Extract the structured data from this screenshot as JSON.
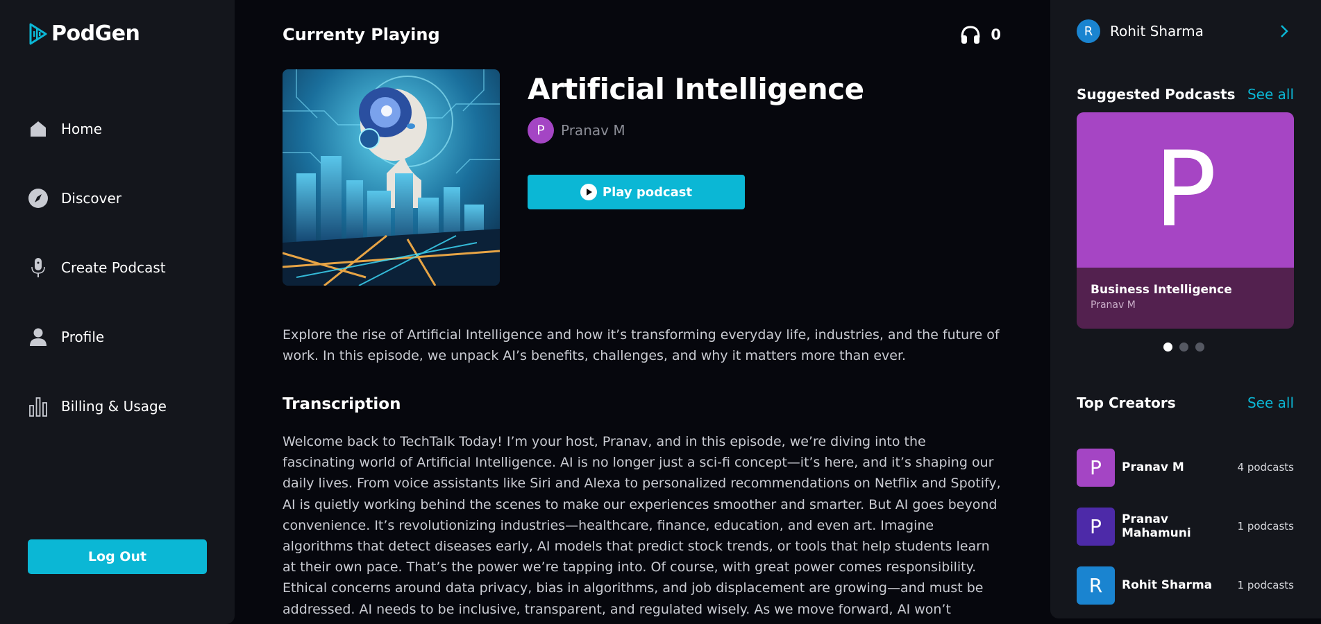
{
  "app": {
    "name": "PodGen"
  },
  "sidebar": {
    "items": [
      {
        "label": "Home",
        "icon": "home-icon"
      },
      {
        "label": "Discover",
        "icon": "compass-icon"
      },
      {
        "label": "Create Podcast",
        "icon": "microphone-icon"
      },
      {
        "label": "Profile",
        "icon": "user-icon"
      },
      {
        "label": "Billing & Usage",
        "icon": "bar-chart-icon"
      }
    ],
    "logout_label": "Log Out"
  },
  "main": {
    "section_title": "Currenty Playing",
    "listeners": "0",
    "podcast": {
      "title": "Artificial Intelligence",
      "author_initial": "P",
      "author": "Pranav M",
      "play_label": "Play podcast",
      "description": "Explore the rise of Artificial Intelligence and how it’s transforming everyday life, industries, and the future of work. In this episode, we unpack AI’s benefits, challenges, and why it matters more than ever."
    },
    "transcription_title": "Transcription",
    "transcription_text": "Welcome back to TechTalk Today! I’m your host, Pranav, and in this episode, we’re diving into the fascinating world of Artificial Intelligence. AI is no longer just a sci-fi concept—it’s here, and it’s shaping our daily lives. From voice assistants like Siri and Alexa to personalized recommendations on Netflix and Spotify, AI is quietly working behind the scenes to make our experiences smoother and smarter. But AI goes beyond convenience. It’s revolutionizing industries—healthcare, finance, education, and even art. Imagine algorithms that detect diseases early, AI models that predict stock trends, or tools that help students learn at their own pace. That’s the power we’re tapping into. Of course, with great power comes responsibility. Ethical concerns around data privacy, bias in algorithms, and job displacement are growing—and must be addressed. AI needs to be inclusive, transparent, and regulated wisely. As we move forward, AI won’t replace humans—but those who use AI"
  },
  "rightbar": {
    "user": {
      "initial": "R",
      "name": "Rohit Sharma"
    },
    "suggested_title": "Suggested Podcasts",
    "see_all": "See all",
    "suggested": {
      "letter": "P",
      "title": "Business Intelligence",
      "author": "Pranav M"
    },
    "top_creators_title": "Top Creators",
    "creators": [
      {
        "initial": "P",
        "name": "Pranav M",
        "count": "4 podcasts",
        "color": "#a445c4"
      },
      {
        "initial": "P",
        "name": "Pranav Mahamuni",
        "count": "1 podcasts",
        "color": "#4d2aa8"
      },
      {
        "initial": "R",
        "name": "Rohit Sharma",
        "count": "1 podcasts",
        "color": "#1a84d0"
      }
    ]
  },
  "colors": {
    "accent": "#0bb7d5",
    "bg": "#06070d",
    "panel": "#14161c"
  }
}
